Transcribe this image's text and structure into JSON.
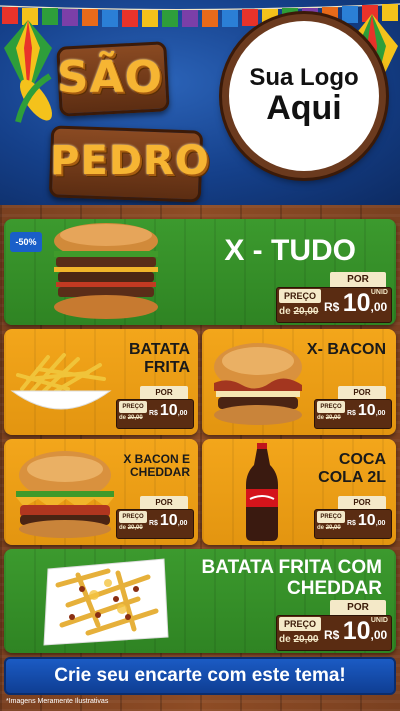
{
  "header": {
    "title_line1": "SÃO",
    "title_line2": "PEDRO",
    "logo_line1": "Sua Logo",
    "logo_line2": "Aqui"
  },
  "discount_badge": "-50%",
  "labels": {
    "por": "POR",
    "preco": "PREÇO",
    "de_prefix": "de",
    "unid": "UNID",
    "currency": "R$"
  },
  "products": [
    {
      "name": "X - TUDO",
      "old_price": "20,00",
      "price_int": "10",
      "price_dec": ",00",
      "image": "burger-stack-icon"
    },
    {
      "name": "BATATA FRITA",
      "old_price": "20,00",
      "price_int": "10",
      "price_dec": ",00",
      "image": "fries-bowl-icon"
    },
    {
      "name": "X- BACON",
      "old_price": "20,00",
      "price_int": "10",
      "price_dec": ",00",
      "image": "bacon-burger-icon"
    },
    {
      "name": "X BACON E CHEDDAR",
      "old_price": "20,00",
      "price_int": "10",
      "price_dec": ",00",
      "image": "cheddar-burger-icon"
    },
    {
      "name": "COCA COLA 2L",
      "old_price": "20,00",
      "price_int": "10",
      "price_dec": ",00",
      "image": "cola-bottle-icon"
    },
    {
      "name": "BATATA FRITA COM CHEDDAR",
      "old_price": "20,00",
      "price_int": "10",
      "price_dec": ",00",
      "image": "fries-cheddar-icon"
    }
  ],
  "cta": "Crie seu encarte com este tema!",
  "footnote": "*Imagens Meramente Ilustrativas",
  "colors": {
    "green": "#3c9a2e",
    "orange": "#f3a61b",
    "wood": "#7a4020",
    "blue": "#1b5bc4"
  }
}
